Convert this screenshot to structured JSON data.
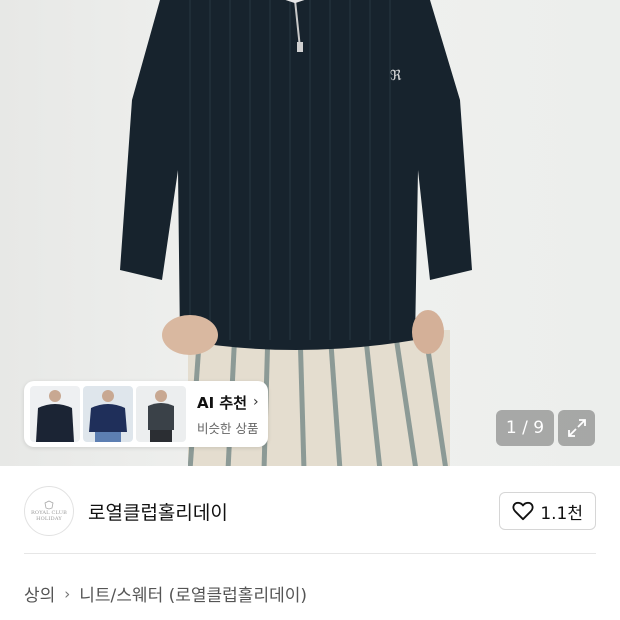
{
  "ai_card": {
    "title": "AI 추천",
    "chevron": "›",
    "subtitle": "비슷한 상품",
    "thumbnails": [
      "thumbnail-1",
      "thumbnail-2",
      "thumbnail-3"
    ]
  },
  "pager": {
    "text": "1 / 9"
  },
  "brand": {
    "name": "로열클럽홀리데이",
    "logo_text": "ROYAL CLUB HOLIDAY"
  },
  "like": {
    "count": "1.1천",
    "icon": "heart-outline-icon"
  },
  "breadcrumb": {
    "category": "상의",
    "separator": "›",
    "subcategory": "니트/스웨터 (로열클럽홀리데이)"
  },
  "colors": {
    "sweater": "#17232d",
    "pager_bg": "#6e6e6e",
    "divider": "#e6e6e6"
  }
}
